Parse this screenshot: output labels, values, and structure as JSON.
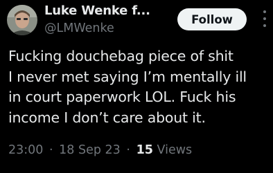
{
  "author": {
    "display_name": "Luke Wenke f...",
    "handle": "@LMWenke"
  },
  "follow_label": "Follow",
  "more_icon": "more-dots-icon",
  "tweet": {
    "lines": [
      "Fucking douchebag piece of shit",
      "I never met saying I’m mentally ill",
      "in court paperwork LOL.  Fuck his",
      "income I don’t care about it."
    ]
  },
  "meta": {
    "time": "23:00",
    "separator": "·",
    "date": "18 Sep 23",
    "views_count": "15",
    "views_label": "Views"
  },
  "colors": {
    "background": "#000000",
    "primary_text": "#e7e9ea",
    "secondary_text": "#71767b",
    "follow_button_bg": "#eff3f4"
  }
}
